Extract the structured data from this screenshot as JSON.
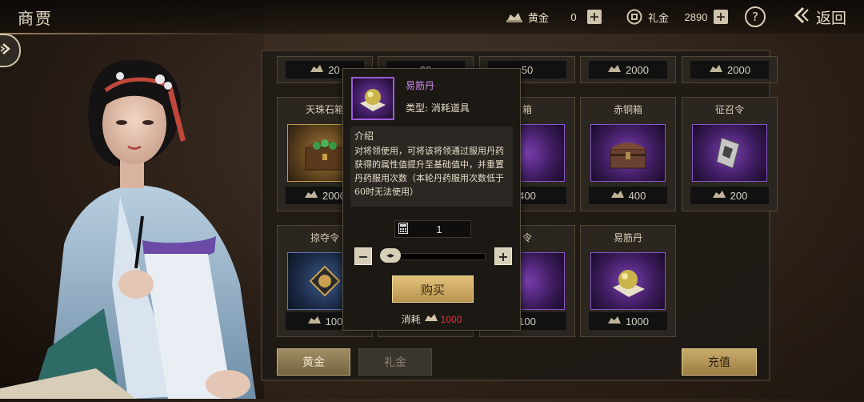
{
  "header": {
    "title": "商贾",
    "gold_label": "黄金",
    "gold_value": "0",
    "gift_label": "礼金",
    "gift_value": "2890",
    "help": "?",
    "back_label": "返回"
  },
  "shop": {
    "top_row": [
      {
        "price": "20"
      },
      {
        "price": "20"
      },
      {
        "price": "50"
      },
      {
        "price": "2000"
      },
      {
        "price": "2000"
      }
    ],
    "middle_row": [
      {
        "name": "天珠石箱",
        "price": "2000",
        "frame": "gold"
      },
      {
        "name": "",
        "price": "",
        "frame": "purple"
      },
      {
        "name": "箱",
        "price": "400",
        "frame": "purple"
      },
      {
        "name": "赤铜箱",
        "price": "400",
        "frame": "purple"
      },
      {
        "name": "征召令",
        "price": "200",
        "frame": "purple"
      }
    ],
    "bottom_row": [
      {
        "name": "掠夺令",
        "price": "100",
        "frame": "blue"
      },
      {
        "name": "",
        "price": "",
        "frame": "purple"
      },
      {
        "name": "令",
        "price": "100",
        "frame": "purple"
      },
      {
        "name": "易筋丹",
        "price": "1000",
        "frame": "purple"
      }
    ],
    "tabs": {
      "gold": "黄金",
      "gift": "礼金"
    },
    "recharge": "充值"
  },
  "popup": {
    "item_name": "易筋丹",
    "type_line": "类型:  消耗道具",
    "desc_heading": "介绍",
    "desc_text": "对将领使用，可将该将领通过服用丹药获得的属性值提升至基础值中，并重置丹药服用次数（本轮丹药服用次数低于60时无法使用）",
    "quantity": "1",
    "minus": "−",
    "plus": "+",
    "slider_value": 0,
    "buy_label": "购买",
    "cost_label": "消耗",
    "cost_value": "1000"
  },
  "colors": {
    "accent_gold": "#c9ac6c",
    "item_name_purple": "#c88ae8",
    "cost_red": "#e0303a"
  }
}
